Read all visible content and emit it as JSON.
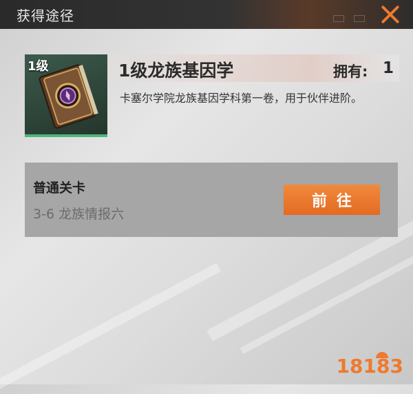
{
  "header": {
    "title": "获得途径"
  },
  "item": {
    "level_badge": "1级",
    "name": "1级龙族基因学",
    "own_label": "拥有:",
    "own_value": "1",
    "description": "卡塞尔学院龙族基因学科第一卷，用于伙伴进阶。",
    "icon": "book-icon"
  },
  "source": {
    "type_label": "普通关卡",
    "stage_label": "3-6 龙族情报六",
    "go_label": "前往"
  },
  "watermark": {
    "text": "18183"
  },
  "colors": {
    "accent": "#ee7a2e",
    "card_bg": "#2e4438",
    "card_border": "#4fb47a",
    "panel": "#a6a6a6"
  }
}
